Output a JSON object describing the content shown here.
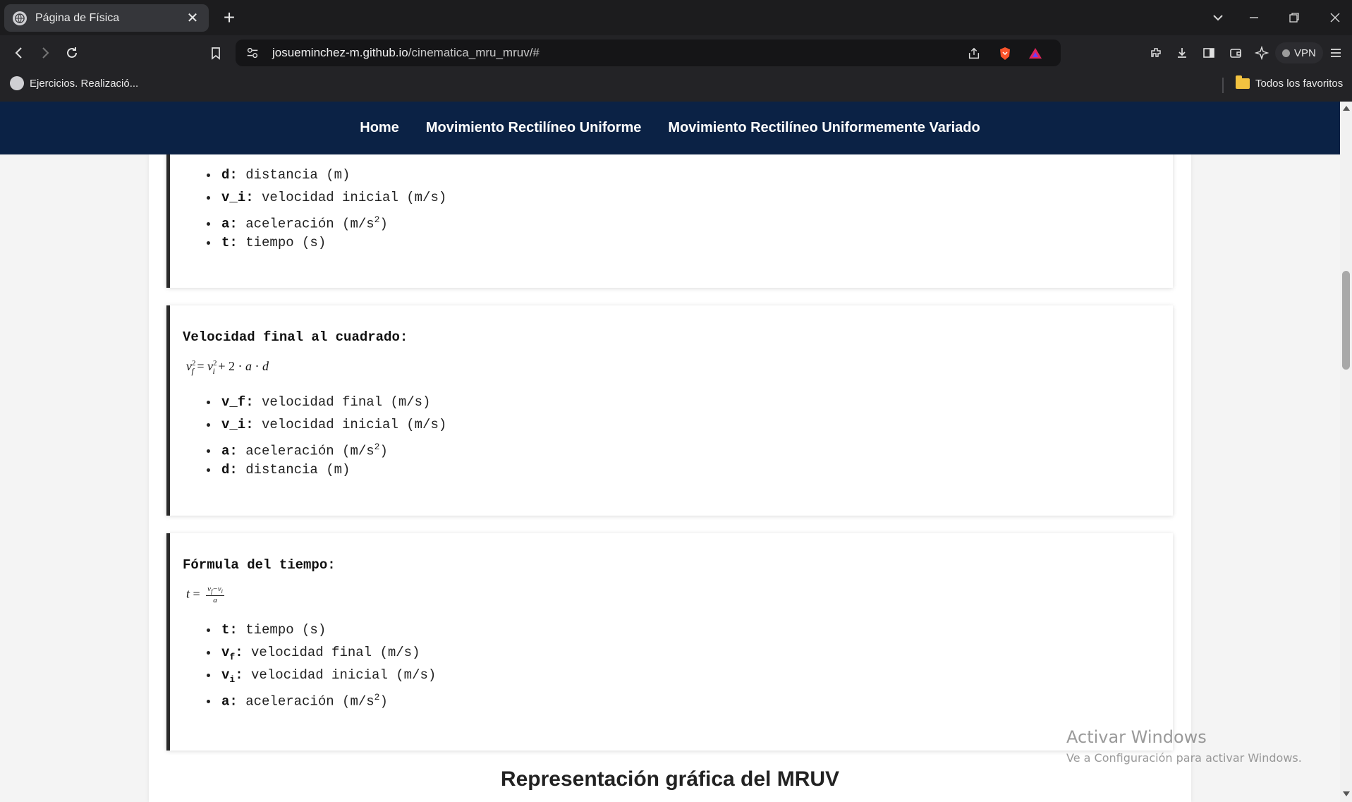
{
  "browser": {
    "tab_title": "Página de Física",
    "url_host": "josueminchez-m.github.io",
    "url_path": "/cinematica_mru_mruv/#",
    "bookmark": "Ejercicios. Realizació...",
    "all_bookmarks": "Todos los favoritos",
    "vpn": "VPN"
  },
  "site_nav": {
    "items": [
      "Home",
      "Movimiento Rectilíneo Uniforme",
      "Movimiento Rectilíneo Uniformemente Variado"
    ]
  },
  "cards": [
    {
      "vars": [
        {
          "sym": "d:",
          "desc": "distancia (m)"
        },
        {
          "sym": "v_i:",
          "desc": "velocidad inicial (m/s)"
        },
        {
          "sym": "a:",
          "desc": "aceleración (m/s",
          "sup": "2",
          "tail": ")"
        },
        {
          "sym": "t:",
          "desc": "tiempo (s)"
        }
      ]
    },
    {
      "title": "Velocidad final al cuadrado:",
      "vars": [
        {
          "sym": "v_f:",
          "desc": "velocidad final (m/s)"
        },
        {
          "sym": "v_i:",
          "desc": "velocidad inicial (m/s)"
        },
        {
          "sym": "a:",
          "desc": "aceleración (m/s",
          "sup": "2",
          "tail": ")"
        },
        {
          "sym": "d:",
          "desc": "distancia (m)"
        }
      ]
    },
    {
      "title": "Fórmula del tiempo:",
      "vars": [
        {
          "sym": "t:",
          "desc": "tiempo (s)"
        },
        {
          "sym": "v",
          "sub": "f",
          "colon": ":",
          "desc": "velocidad final (m/s)"
        },
        {
          "sym": "v",
          "sub": "i",
          "colon": ":",
          "desc": "velocidad inicial (m/s)"
        },
        {
          "sym": "a:",
          "desc": "aceleración (m/s",
          "sup": "2",
          "tail": ")"
        }
      ]
    }
  ],
  "section_heading": "Representación gráfica del MRUV",
  "watermark": {
    "line1": "Activar Windows",
    "line2": "Ve a Configuración para activar Windows."
  }
}
